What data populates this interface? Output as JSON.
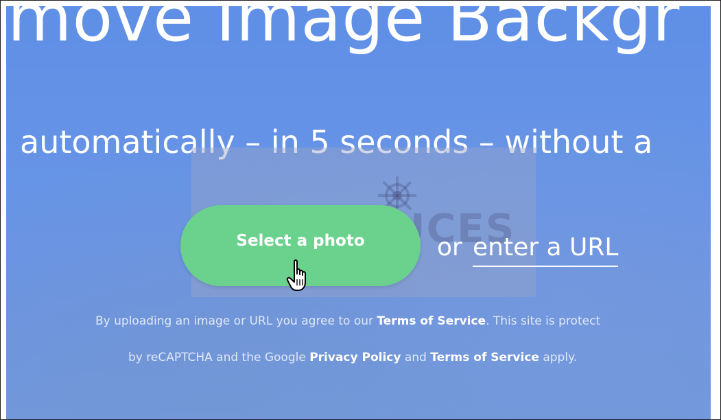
{
  "hero": {
    "headline": "move Image Backgr",
    "subline": "automatically – in 5 seconds – without a"
  },
  "upload": {
    "select_label": "Select a photo",
    "or_text": "or",
    "url_label": "enter a URL"
  },
  "terms": {
    "line1_prefix": "By uploading an image or URL you agree to our ",
    "line1_link": "Terms of Service",
    "line1_suffix": ". This site is protect",
    "line2_prefix": "by reCAPTCHA and the Google ",
    "line2_link1": "Privacy Policy",
    "line2_mid": " and ",
    "line2_link2": "Terms of Service",
    "line2_suffix": " apply."
  },
  "watermark": {
    "text": "PC ASTUCES"
  },
  "colors": {
    "background": "#6794e6",
    "button": "#6bd28e",
    "text": "#ffffff"
  },
  "icons": {
    "cursor": "hand-pointer-icon",
    "watermark_logo": "ship-wheel-icon"
  }
}
